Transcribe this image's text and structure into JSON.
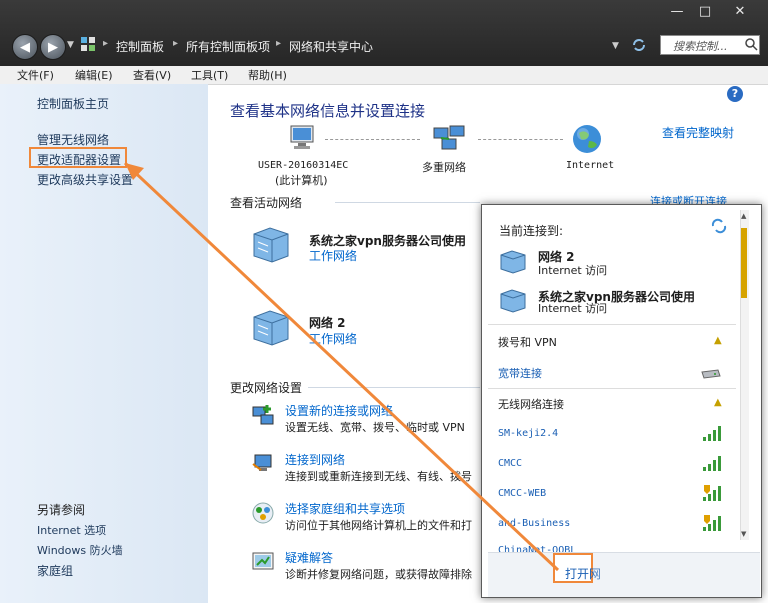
{
  "window_controls": {
    "minimize": "—",
    "maximize": "□",
    "close": "✕"
  },
  "breadcrumbs": [
    "控制面板",
    "所有控制面板项",
    "网络和共享中心"
  ],
  "search": {
    "placeholder": "搜索控制..."
  },
  "menu": [
    "文件(F)",
    "编辑(E)",
    "查看(V)",
    "工具(T)",
    "帮助(H)"
  ],
  "left": {
    "home": "控制面板主页",
    "links": [
      "管理无线网络",
      "更改适配器设置",
      "更改高级共享设置"
    ],
    "see_also": "另请参阅",
    "bottom": [
      "Internet 选项",
      "Windows 防火墙",
      "家庭组"
    ]
  },
  "main": {
    "title": "查看基本网络信息并设置连接",
    "view_full_map": "查看完整映射",
    "map": {
      "computer": "USER-20160314EC",
      "computer_sub": "(此计算机)",
      "middle": "多重网络",
      "right": "Internet"
    },
    "active_title": "查看活动网络",
    "connect_disconnect": "连接或断开连接",
    "networks": [
      {
        "name": "系统之家vpn服务器公司使用",
        "type": "工作网络"
      },
      {
        "name": "网络  2",
        "type": "工作网络"
      }
    ],
    "change_title": "更改网络设置",
    "tasks": [
      {
        "link": "设置新的连接或网络",
        "desc": "设置无线、宽带、拨号、临时或 VPN"
      },
      {
        "link": "连接到网络",
        "desc": "连接到或重新连接到无线、有线、拨号"
      },
      {
        "link": "选择家庭组和共享选项",
        "desc": "访问位于其他网络计算机上的文件和打"
      },
      {
        "link": "疑难解答",
        "desc": "诊断并修复网络问题，或获得故障排除"
      }
    ]
  },
  "popup": {
    "current": "当前连接到:",
    "connections": [
      {
        "name": "网络  2",
        "status": "Internet 访问"
      },
      {
        "name": "系统之家vpn服务器公司使用",
        "status": "Internet 访问"
      }
    ],
    "dialup_title": "拨号和 VPN",
    "broadband": "宽带连接",
    "wireless_title": "无线网络连接",
    "wifi": [
      "SM-keji2.4",
      "CMCC",
      "CMCC-WEB",
      "and-Business",
      "ChinaNet-OQBL"
    ],
    "open_button": "打开网"
  },
  "colors": {
    "accent": "#f0883a",
    "link": "#0066cc",
    "titlebar": "#2f2f2f"
  }
}
